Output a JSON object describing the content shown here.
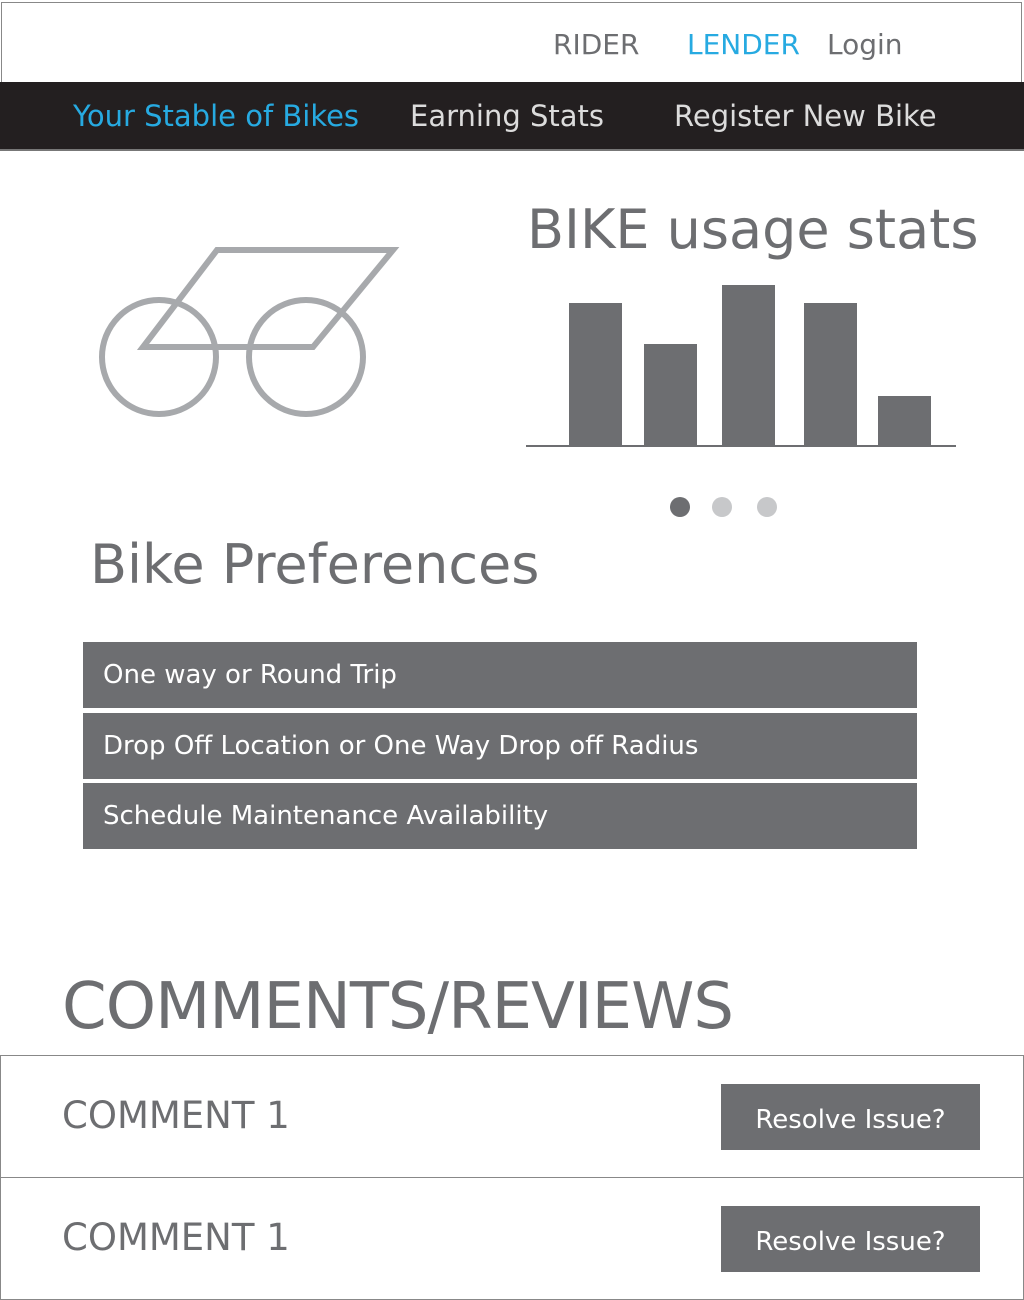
{
  "header": {
    "links": [
      "RIDER",
      "LENDER",
      "Login"
    ],
    "active_color": "#27aae1"
  },
  "nav": {
    "items": [
      "Your Stable of Bikes",
      "Earning Stats",
      "Register New Bike"
    ]
  },
  "bike_icon": "bike-icon",
  "stats": {
    "title": "BIKE usage stats",
    "carousel_active_index": 0,
    "carousel_count": 3
  },
  "chart_data": {
    "type": "bar",
    "values": [
      143,
      102,
      161,
      143,
      50
    ],
    "ylim": [
      0,
      170
    ],
    "color": "#6d6e71",
    "grid": false
  },
  "preferences": {
    "title": "Bike Preferences",
    "items": [
      "One way or Round Trip",
      "Drop Off Location or One Way Drop off Radius",
      "Schedule Maintenance Availability"
    ]
  },
  "comments": {
    "title": "COMMENTS/REVIEWS",
    "items": [
      {
        "text": "COMMENT 1",
        "action": "Resolve Issue?"
      },
      {
        "text": "COMMENT 1",
        "action": "Resolve Issue?"
      }
    ]
  }
}
